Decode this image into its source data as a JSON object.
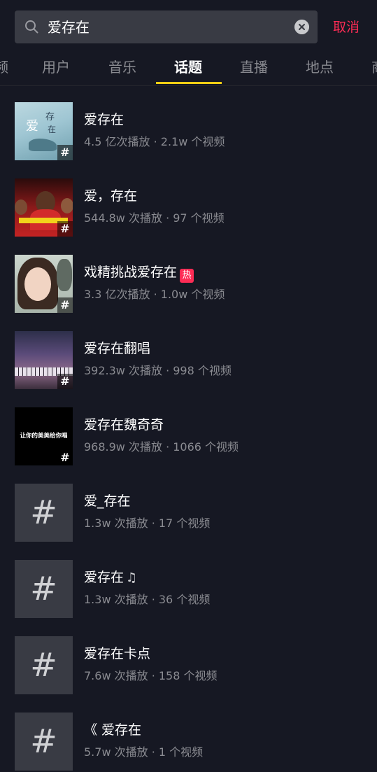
{
  "search": {
    "query": "爱存在",
    "cancel_label": "取消"
  },
  "tabs": [
    {
      "label": "频"
    },
    {
      "label": "用户"
    },
    {
      "label": "音乐"
    },
    {
      "label": "话题"
    },
    {
      "label": "直播"
    },
    {
      "label": "地点"
    },
    {
      "label": "商"
    }
  ],
  "active_tab": "话题",
  "topics": [
    {
      "title": "爱存在",
      "meta": "4.5 亿次播放 · 2.1w 个视频",
      "thumb_text_1": "存",
      "thumb_text_2": "在",
      "thumb_text_3": "爱"
    },
    {
      "title": "爱，存在",
      "meta": "544.8w 次播放 · 97 个视频"
    },
    {
      "title": "戏精挑战爱存在",
      "meta": "3.3 亿次播放 · 1.0w 个视频",
      "badge": "热"
    },
    {
      "title": "爱存在翻唱",
      "meta": "392.3w 次播放 · 998 个视频"
    },
    {
      "title": "爱存在魏奇奇",
      "meta": "968.9w 次播放 · 1066 个视频",
      "thumb_text": "让你的美美给你唱"
    },
    {
      "title": "爱_存在",
      "meta": "1.3w 次播放 · 17 个视频"
    },
    {
      "title": "爱存在",
      "meta": "1.3w 次播放 · 36 个视频",
      "icon": "music-note-icon"
    },
    {
      "title": "爱存在卡点",
      "meta": "7.6w 次播放 · 158 个视频"
    },
    {
      "title": "《 爱存在",
      "meta": "5.7w 次播放 · 1 个视频"
    }
  ],
  "hash_symbol": "#",
  "colors": {
    "background": "#161823",
    "accent": "#fe2c55",
    "tab_indicator": "#face15"
  }
}
